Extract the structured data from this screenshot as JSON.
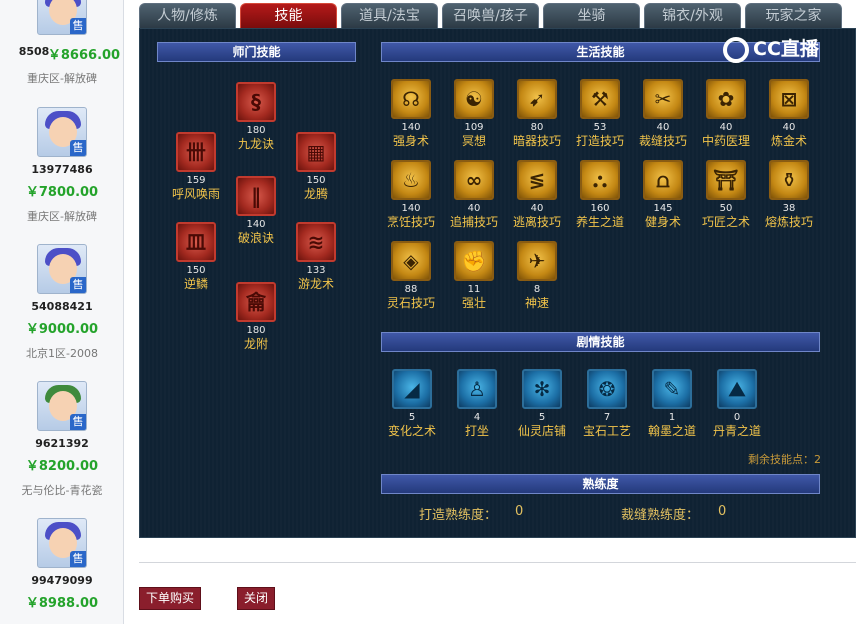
{
  "tabs": [
    "人物/修炼",
    "技能",
    "道具/法宝",
    "召唤兽/孩子",
    "坐骑",
    "锦衣/外观",
    "玩家之家"
  ],
  "active_tab": "技能",
  "listings": [
    {
      "id": "8508",
      "price": "￥8666.00",
      "server": "重庆区-解放碑"
    },
    {
      "id": "13977486",
      "price": "￥7800.00",
      "server": "重庆区-解放碑"
    },
    {
      "id": "54088421",
      "price": "￥9000.00",
      "server": "北京1区-2008"
    },
    {
      "id": "9621392",
      "price": "￥8200.00",
      "server": "无与伦比-青花瓷"
    },
    {
      "id": "99479099",
      "price": "￥8988.00",
      "server": ""
    }
  ],
  "sale_badge": "售",
  "sections": {
    "school": "师门技能",
    "life": "生活技能",
    "story": "剧情技能",
    "proficiency": "熟练度"
  },
  "school_skills": [
    {
      "name": "九龙诀",
      "level": "180",
      "icon": "dragon-icon"
    },
    {
      "name": "呼风唤雨",
      "level": "159",
      "icon": "wind-icon"
    },
    {
      "name": "龙腾",
      "level": "150",
      "icon": "rise-icon"
    },
    {
      "name": "破浪诀",
      "level": "140",
      "icon": "wave-icon"
    },
    {
      "name": "逆鳞",
      "level": "150",
      "icon": "scale-icon"
    },
    {
      "name": "游龙术",
      "level": "133",
      "icon": "swim-icon"
    },
    {
      "name": "龙附",
      "level": "180",
      "icon": "attach-icon"
    }
  ],
  "life_skills": [
    {
      "name": "强身术",
      "level": "140"
    },
    {
      "name": "冥想",
      "level": "109"
    },
    {
      "name": "暗器技巧",
      "level": "80"
    },
    {
      "name": "打造技巧",
      "level": "53"
    },
    {
      "name": "裁缝技巧",
      "level": "40"
    },
    {
      "name": "中药医理",
      "level": "40"
    },
    {
      "name": "炼金术",
      "level": "40"
    },
    {
      "name": "烹饪技巧",
      "level": "140"
    },
    {
      "name": "追捕技巧",
      "level": "40"
    },
    {
      "name": "逃离技巧",
      "level": "40"
    },
    {
      "name": "养生之道",
      "level": "160"
    },
    {
      "name": "健身术",
      "level": "145"
    },
    {
      "name": "巧匠之术",
      "level": "50"
    },
    {
      "name": "熔炼技巧",
      "level": "38"
    },
    {
      "name": "灵石技巧",
      "level": "88"
    },
    {
      "name": "强壮",
      "level": "11"
    },
    {
      "name": "神速",
      "level": "8"
    }
  ],
  "story_skills": [
    {
      "name": "变化之术",
      "level": "5"
    },
    {
      "name": "打坐",
      "level": "4"
    },
    {
      "name": "仙灵店铺",
      "level": "5"
    },
    {
      "name": "宝石工艺",
      "level": "7"
    },
    {
      "name": "翰墨之道",
      "level": "1"
    },
    {
      "name": "丹青之道",
      "level": "0"
    }
  ],
  "remaining_points": "剩余技能点：2",
  "proficiency": [
    {
      "label": "打造熟练度：",
      "value": "0"
    },
    {
      "label": "裁缝熟练度：",
      "value": "0"
    }
  ],
  "buttons": {
    "buy": "下单购买",
    "close": "关闭"
  },
  "watermark": "CC直播",
  "colors": {
    "panel": "#0f2233",
    "tab_active": "#b41a1a",
    "price": "#24a32b",
    "skill_name": "#f2c44a"
  }
}
